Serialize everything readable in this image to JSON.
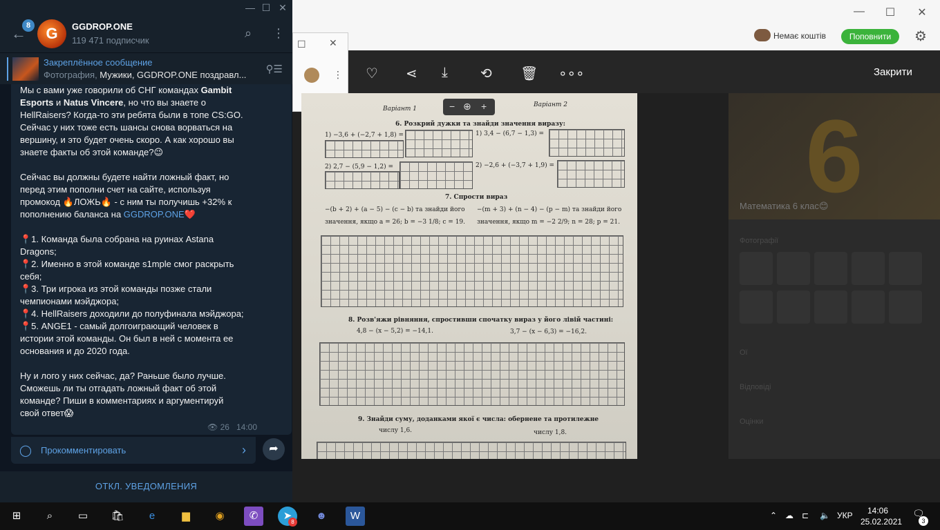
{
  "telegram": {
    "unread_count": "8",
    "avatar_letter": "G",
    "channel_name": "GGDROP.ONE",
    "subscribers": "119 471 подписчик",
    "pinned": {
      "title": "Закреплённое сообщение",
      "prefix": "Фотография, ",
      "text": "Мужики, GGDROP.ONE поздравл..."
    },
    "message": {
      "p1_before": "Мы с вами уже говорили об СНГ командах ",
      "p1_bold1": "Gambit Esports",
      "p1_mid": " и ",
      "p1_bold2": "Natus Vincere",
      "p1_after": ", но что вы знаете о HellRaisers? Когда-то эти ребята были в топе CS:GO. Сейчас у них тоже есть шансы снова ворваться на вершину, и это будет очень скоро. А как хорошо вы знаете факты об этой команде?😉",
      "p2_before": "Сейчас вы должны будете найти ложный факт, но перед этим пополни счет на сайте, используя промокод 🔥ЛОЖЬ🔥 - с ним ты получишь +32% к пополнению баланса на ",
      "p2_link": "GGDROP.ONE",
      "p2_after": "❤️",
      "facts": [
        "📍1. Команда была собрана на руинах Astana Dragons;",
        "📍2. Именно в этой команде s1mple смог раскрыть себя;",
        "📍3. Три игрока из этой команды позже стали чемпионами мэйджора;",
        "📍4. HellRaisers доходили до полуфинала мэйджора;",
        "📍5. ANGE1 - самый долгоиграющий человек в истории этой команды. Он был в ней с момента ее основания и до 2020 года."
      ],
      "p4": "Ну и лого у них сейчас, да? Раньше было лучше. Сможешь ли ты отгадать ложный факт об этой команде? Пиши в комментариях и аргументируй свой ответ😱",
      "views": "26",
      "time": "14:00"
    },
    "comment_label": "Прокомментировать",
    "mute_label": "ОТКЛ. УВЕДОМЛЕНИЯ"
  },
  "viewer": {
    "no_funds": "Немає коштів",
    "topup": "Поповнити",
    "close": "Закрити",
    "bg_title": "Математика 6 клас😊",
    "bg_banner": "6",
    "bg_labels": [
      "Фотографії",
      "Ої",
      "Відповіді",
      "Оцінки"
    ]
  },
  "document": {
    "variant1": "Варіант 1",
    "variant2": "Варіант 2",
    "task6": "6. Розкрий дужки та знайди значення виразу:",
    "t6a": "1) −3,6 + (−2,7 + 1,8) =",
    "t6b": "1) 3,4 − (6,7 − 1,3) =",
    "t6c": "2) 2,7 − (5,9 − 1,2) =",
    "t6d": "2) −2,6 + (−3,7 + 1,9) =",
    "task7": "7. Спрости вираз",
    "t7a1": "−(b + 2) + (a − 5) − (c − b) та знайди його",
    "t7a2": "значення, якщо a = 26; b = −3 1/8; c = 19.",
    "t7b1": "−(m + 3) + (n − 4) − (p − m) та знайди його",
    "t7b2": "значення, якщо m = −2 2/9; n = 28; p = 21.",
    "task8": "8. Розв'яжи рівняння, спростивши спочатку вираз у його лівій частині:",
    "t8a": "4,8 − (x − 5,2) = −14,1.",
    "t8b": "3,7 − (x − 6,3) = −16,2.",
    "task9": "9. Знайди суму, доданками якої є числа: обернене та протилежне",
    "t9a": "числу 1,6.",
    "t9b": "числу 1,8."
  },
  "taskbar": {
    "lang": "УКР",
    "time": "14:06",
    "date": "25.02.2021",
    "notif_count": "3",
    "telegram_badge": "8"
  }
}
